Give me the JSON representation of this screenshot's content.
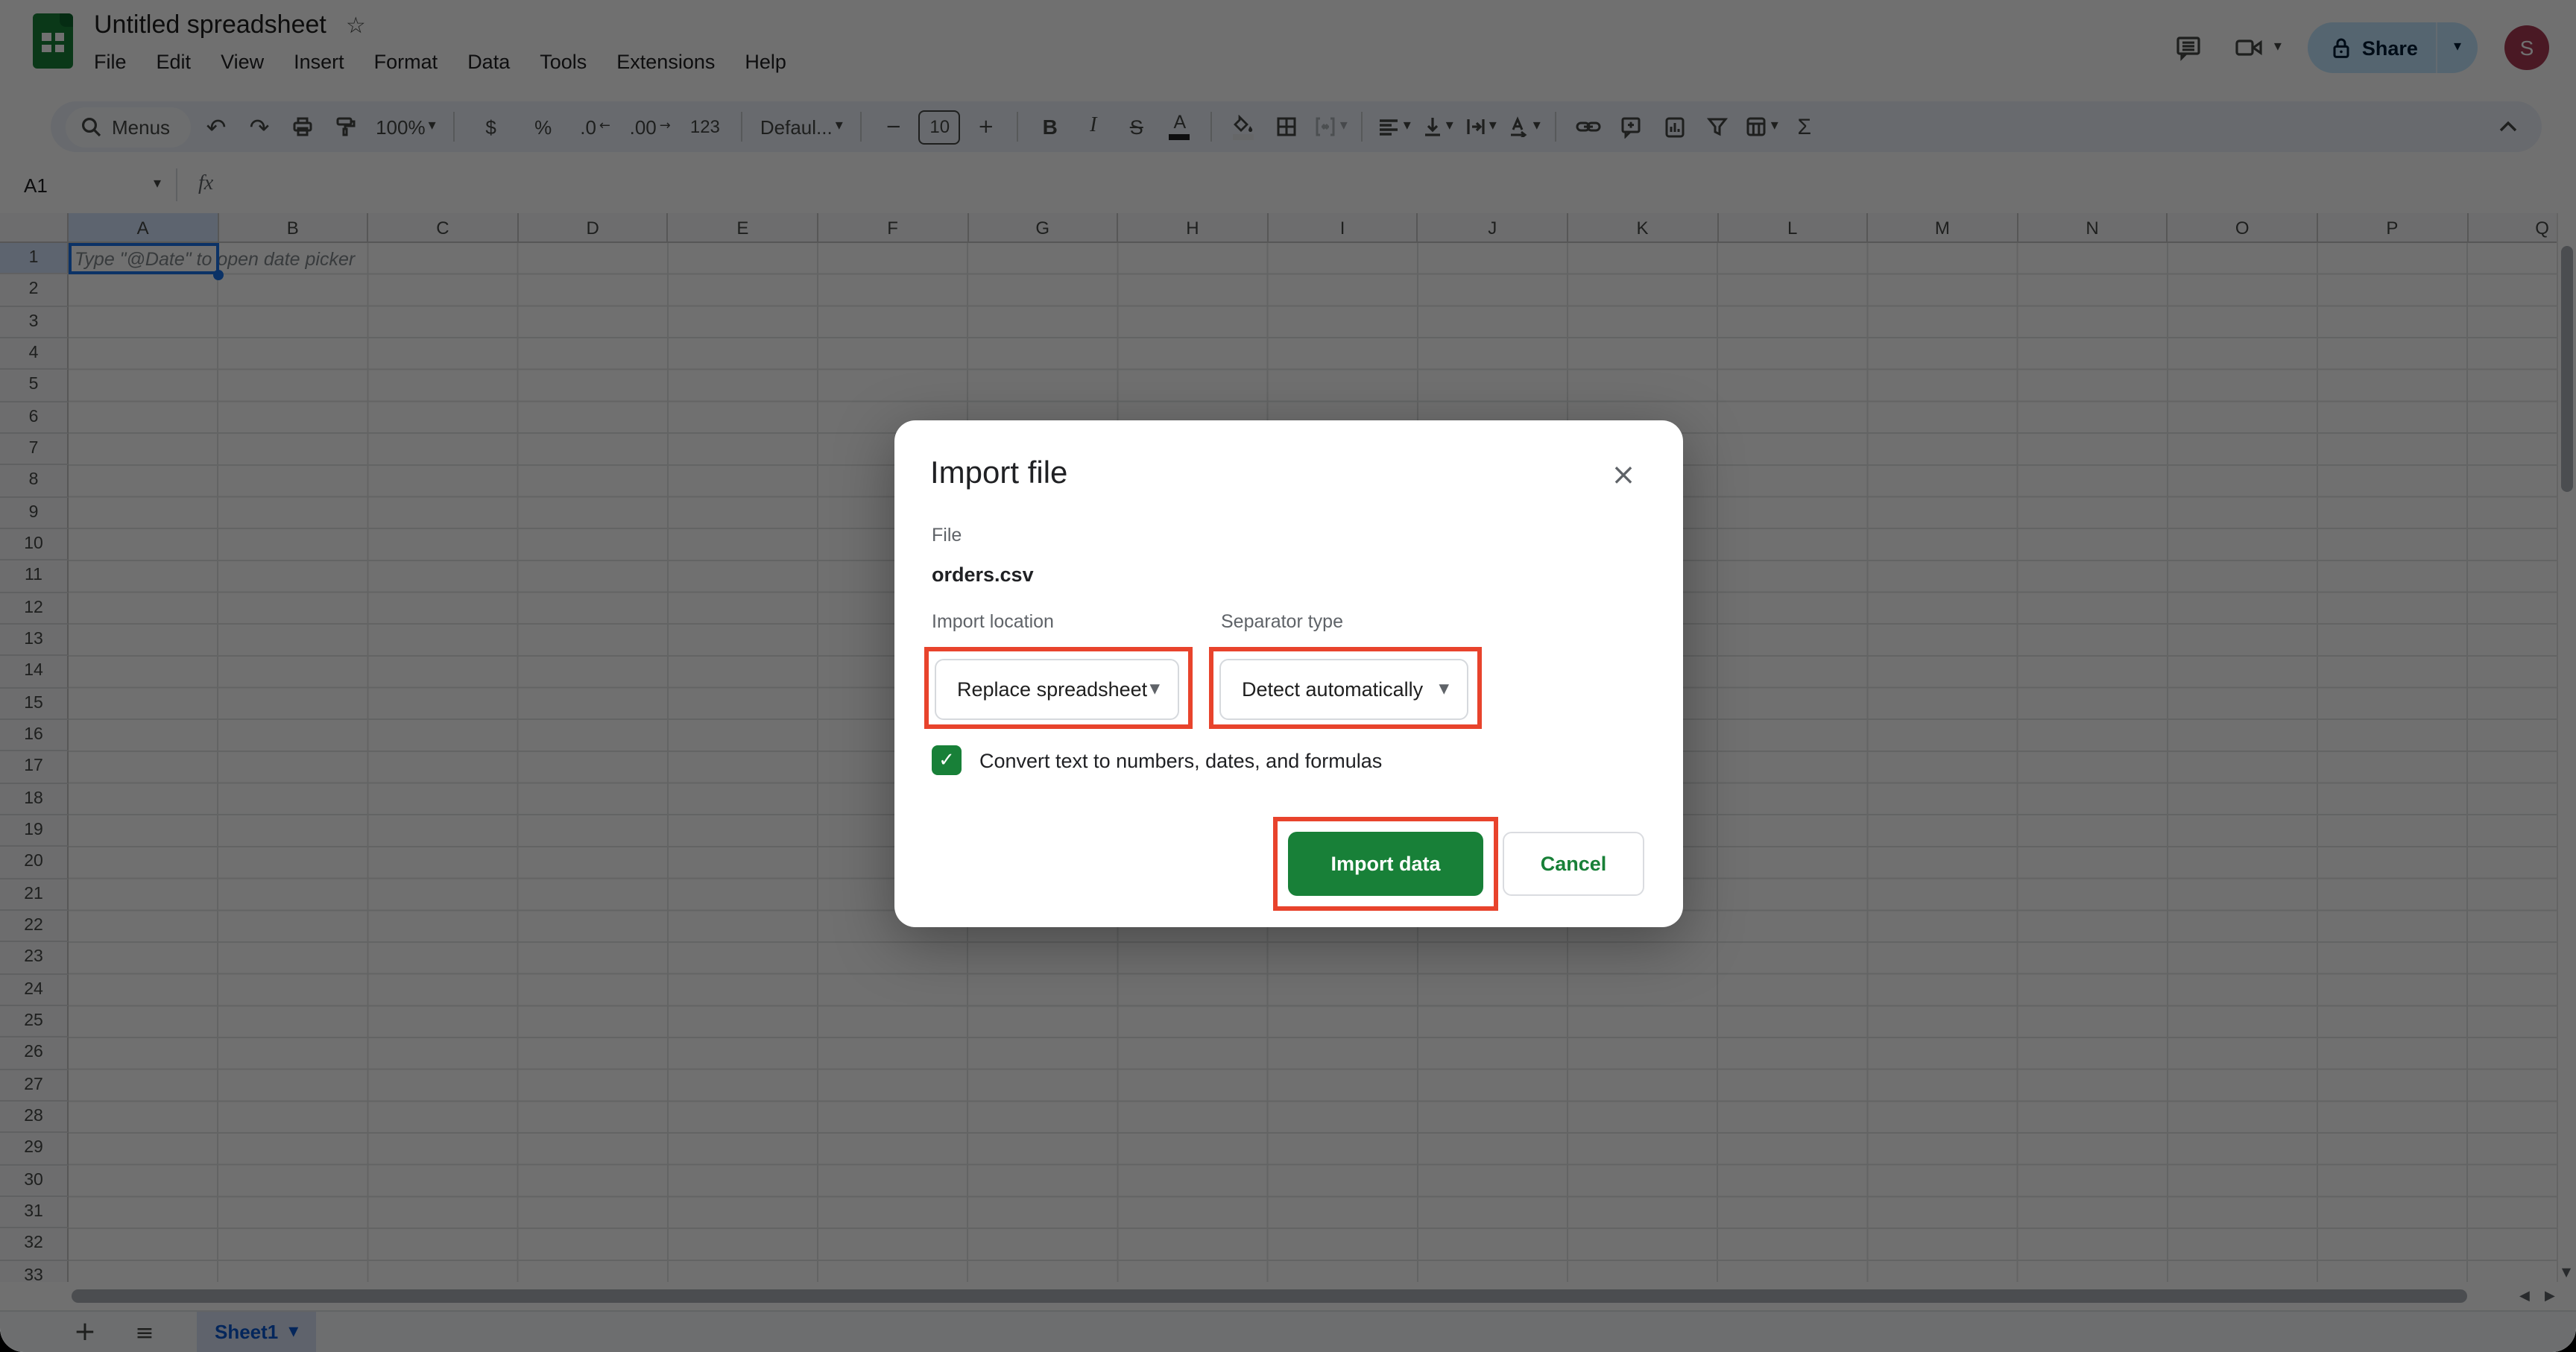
{
  "colors": {
    "annotation_red": "#e8432c",
    "primary_green": "#188038",
    "selection_blue": "#1a73e8",
    "active_tab_blue": "#0b57d0",
    "share_pill_bg": "#c2e7ff",
    "share_pill_text": "#001d35",
    "avatar_bg": "#a83a52",
    "toolbar_bg": "#edf2fa",
    "header_highlight": "#d3e3fd"
  },
  "header": {
    "title": "Untitled spreadsheet",
    "menus": [
      "File",
      "Edit",
      "View",
      "Insert",
      "Format",
      "Data",
      "Tools",
      "Extensions",
      "Help"
    ],
    "share_label": "Share",
    "avatar_initial": "S"
  },
  "toolbar": {
    "menus_label": "Menus",
    "zoom_value": "100%",
    "currency": "$",
    "percent": "%",
    "decrease_decimal": ".0",
    "increase_decimal": ".00",
    "number_format": "123",
    "font_name": "Defaul...",
    "font_size": "10",
    "bold": "B",
    "italic": "I",
    "strikethrough": "S",
    "text_color": "A",
    "functions": "Σ"
  },
  "formula_bar": {
    "cell_reference": "A1",
    "fx_label": "fx"
  },
  "grid": {
    "columns": [
      "A",
      "B",
      "C",
      "D",
      "E",
      "F",
      "G",
      "H",
      "I",
      "J",
      "K",
      "L",
      "M",
      "N",
      "O",
      "P",
      "Q"
    ],
    "row_count": 33,
    "selected_cell": "A1",
    "selected_column": "A",
    "selected_row": 1,
    "a1_placeholder": "Type \"@Date\" to open date picker"
  },
  "dialog": {
    "title": "Import file",
    "file_label": "File",
    "file_name": "orders.csv",
    "import_location_label": "Import location",
    "import_location_value": "Replace spreadsheet",
    "separator_type_label": "Separator type",
    "separator_type_value": "Detect automatically",
    "convert_checkbox_label": "Convert text to numbers, dates, and formulas",
    "convert_checkbox_checked": true,
    "import_button_label": "Import data",
    "cancel_button_label": "Cancel"
  },
  "sheet_bar": {
    "active_sheet": "Sheet1"
  },
  "icons": {
    "star": "☆",
    "caret_down": "▾",
    "undo": "↶",
    "redo": "↷",
    "close": "×",
    "plus": "+",
    "minus": "−",
    "hamburger": "≡",
    "check": "✓",
    "decrease_arrow": "←",
    "increase_arrow": "→",
    "scroll_left": "◀",
    "scroll_right": "▶",
    "scroll_down": "▼"
  }
}
